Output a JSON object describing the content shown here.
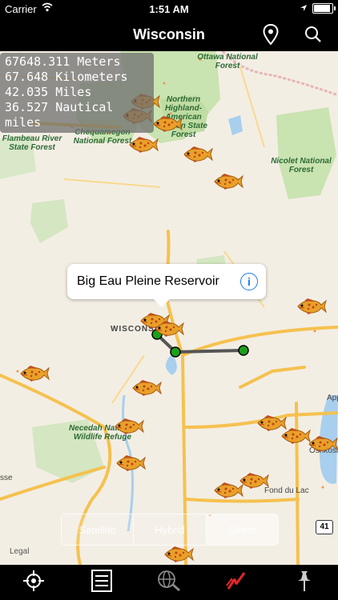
{
  "status": {
    "carrier": "Carrier",
    "time": "1:51 AM"
  },
  "nav": {
    "title": "Wisconsin"
  },
  "distance": {
    "meters": "67648.311 Meters",
    "kilometers": "67.648 Kilometers",
    "miles": "42.035 Miles",
    "nautical": "36.527 Nautical miles"
  },
  "map_labels": {
    "ottawa": "Ottawa National Forest",
    "northern_highland": "Northern Highland-American Legion State Forest",
    "chequamegon": "Chequamegon National Forest",
    "flambeau": "Flambeau River State Forest",
    "nicolet": "Nicolet National Forest",
    "wisconsin": "WISCONSIN",
    "necedah": "Necedah National Wildlife Refuge",
    "fond_du_lac": "Fond du Lac",
    "oshkosh": "Oshkosh",
    "appleton": "Appleton",
    "edge_left": "sse",
    "highway": "41"
  },
  "callout": {
    "title": "Big Eau Pleine Reservoir",
    "info_icon": "info-icon"
  },
  "map_type": {
    "options": [
      "Satellite",
      "Hybrid",
      "Street"
    ],
    "selected": "Street"
  },
  "legal": "Legal",
  "tabs": [
    "crosshair-icon",
    "list-icon",
    "globe-search-icon",
    "lightning-icon",
    "pushpin-icon"
  ],
  "colors": {
    "forest": "#c9e3b1",
    "road": "#f5c14f",
    "water": "#a8cfee",
    "active_tab": "#e3262b"
  }
}
